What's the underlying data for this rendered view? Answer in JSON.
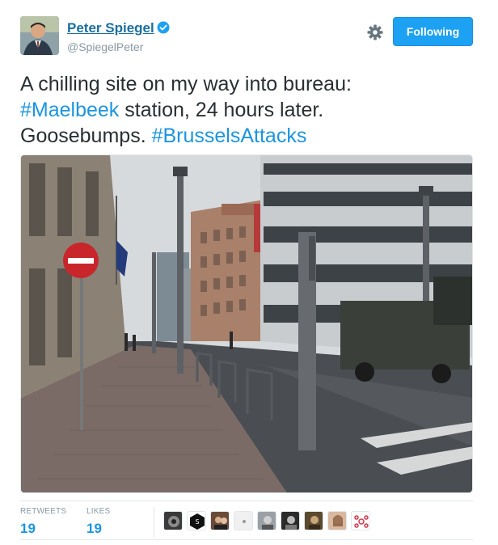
{
  "author": {
    "display_name": "Peter Spiegel",
    "handle": "@SpiegelPeter",
    "verified_icon": "verified-badge-icon",
    "avatar_icon": "avatar"
  },
  "actions": {
    "settings_icon": "gear-icon",
    "follow_label": "Following"
  },
  "tweet": {
    "line1": "A chilling site on my way into bureau:",
    "hashtag1": "#Maelbeek",
    "line2_rest": " station, 24 hours later.",
    "line3_start": "Goosebumps. ",
    "hashtag2": "#BrusselsAttacks"
  },
  "photo": {
    "description_icon": "street-photo"
  },
  "stats": {
    "retweets_label": "RETWEETS",
    "retweets_value": "19",
    "likes_label": "LIKES",
    "likes_value": "19"
  },
  "colors": {
    "accent": "#1da1f2",
    "link": "#1b95e0",
    "name": "#1b6f9e",
    "muted": "#8899a6"
  }
}
